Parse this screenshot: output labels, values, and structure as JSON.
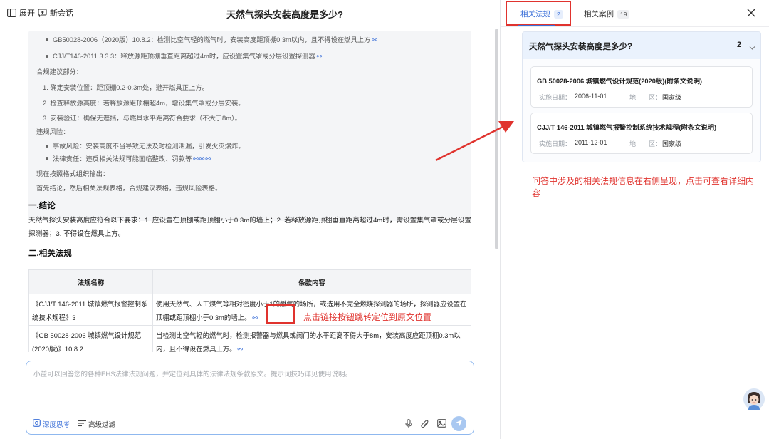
{
  "topbar": {
    "expand_label": "展开",
    "new_chat_label": "新会话",
    "title": "天然气探头安装高度是多少?"
  },
  "thinking": {
    "bullets_top": [
      "GB50028-2006（2020版）10.8.2：检测比空气轻的燃气时，安装高度距顶棚0.3m以内，且不得设在燃具上方",
      "CJJ/T146-2011 3.3.3：释放源距顶棚垂直距离超过4m时，应设置集气罩或分层设置探测器"
    ],
    "compliance_heading": "合规建议部分：",
    "compliance_items": [
      "1. 确定安装位置：距顶棚0.2-0.3m处，避开燃具正上方。",
      "2. 检查释放源高度：若释放源距顶棚超4m，增设集气罩或分层安装。",
      "3. 安装验证：确保无遮挡，与燃具水平距离符合要求（不大于8m）。"
    ],
    "risk_heading": "违规风险：",
    "risk_items": [
      "事故风险：安装高度不当导致无法及时检测泄漏，引发火灾爆炸。",
      "法律责任：违反相关法规可能面临整改、罚款等"
    ],
    "org_line": "现在按照格式组织输出：",
    "order_line": "首先结论，然后相关法规表格，合规建议表格，违规风险表格。"
  },
  "conclusion": {
    "heading": "一.结论",
    "text": "天然气探头安装高度应符合以下要求：1. 应设置在顶棚或距顶棚小于0.3m的墙上；2. 若释放源距顶棚垂直距离超过4m时，需设置集气罩或分层设置探测器；3. 不得设在燃具上方。"
  },
  "regs": {
    "heading": "二.相关法规",
    "col_name": "法规名称",
    "col_content": "条款内容",
    "rows": [
      {
        "name": "《CJJ/T 146-2011 城镇燃气报警控制系统技术规程》3",
        "content": "使用天然气、人工煤气等相对密度小于1的燃气的场所，或选用不完全燃烧探测器的场所，探测器应设置在顶棚或距顶棚小于0.3m的墙上。"
      },
      {
        "name": "《GB 50028-2006 城镇燃气设计规范(2020版)》10.8.2",
        "content": "当检测比空气轻的燃气时，检测报警器与燃具或阀门的水平距离不得大于8m，安装高度应距顶棚0.3m以内，且不得设在燃具上方。"
      }
    ]
  },
  "link_glyph": "⚯",
  "annotations": {
    "link_jump": "点击链接按钮跳转定位到原文位置",
    "right_panel": "问答中涉及的相关法规信息在右侧呈现，点击可查看详细内容"
  },
  "input": {
    "placeholder": "小益可以回答您的各种EHS法律法规问题，并定位到具体的法律法规条款原文。提示词技巧详见使用说明。",
    "deep_think_label": "深度思考",
    "advanced_filter_label": "高级过滤"
  },
  "right_panel": {
    "tabs": [
      {
        "label": "相关法规",
        "count": "2"
      },
      {
        "label": "相关案例",
        "count": "19"
      }
    ],
    "group": {
      "title": "天然气探头安装高度是多少?",
      "count": "2",
      "cards": [
        {
          "title": "GB 50028-2006 城镇燃气设计规范(2020版)(附条文说明)",
          "date_label": "实施日期：",
          "date": "2006-11-01",
          "region_label": "地　　区：",
          "region": "国家级"
        },
        {
          "title": "CJJ/T 146-2011 城镇燃气报警控制系统技术规程(附条文说明)",
          "date_label": "实施日期：",
          "date": "2011-12-01",
          "region_label": "地　　区：",
          "region": "国家级"
        }
      ]
    }
  },
  "colors": {
    "accent": "#3a6fd8",
    "annotation_red": "#e0332e",
    "panel_header_bg": "#eaf2fd"
  }
}
